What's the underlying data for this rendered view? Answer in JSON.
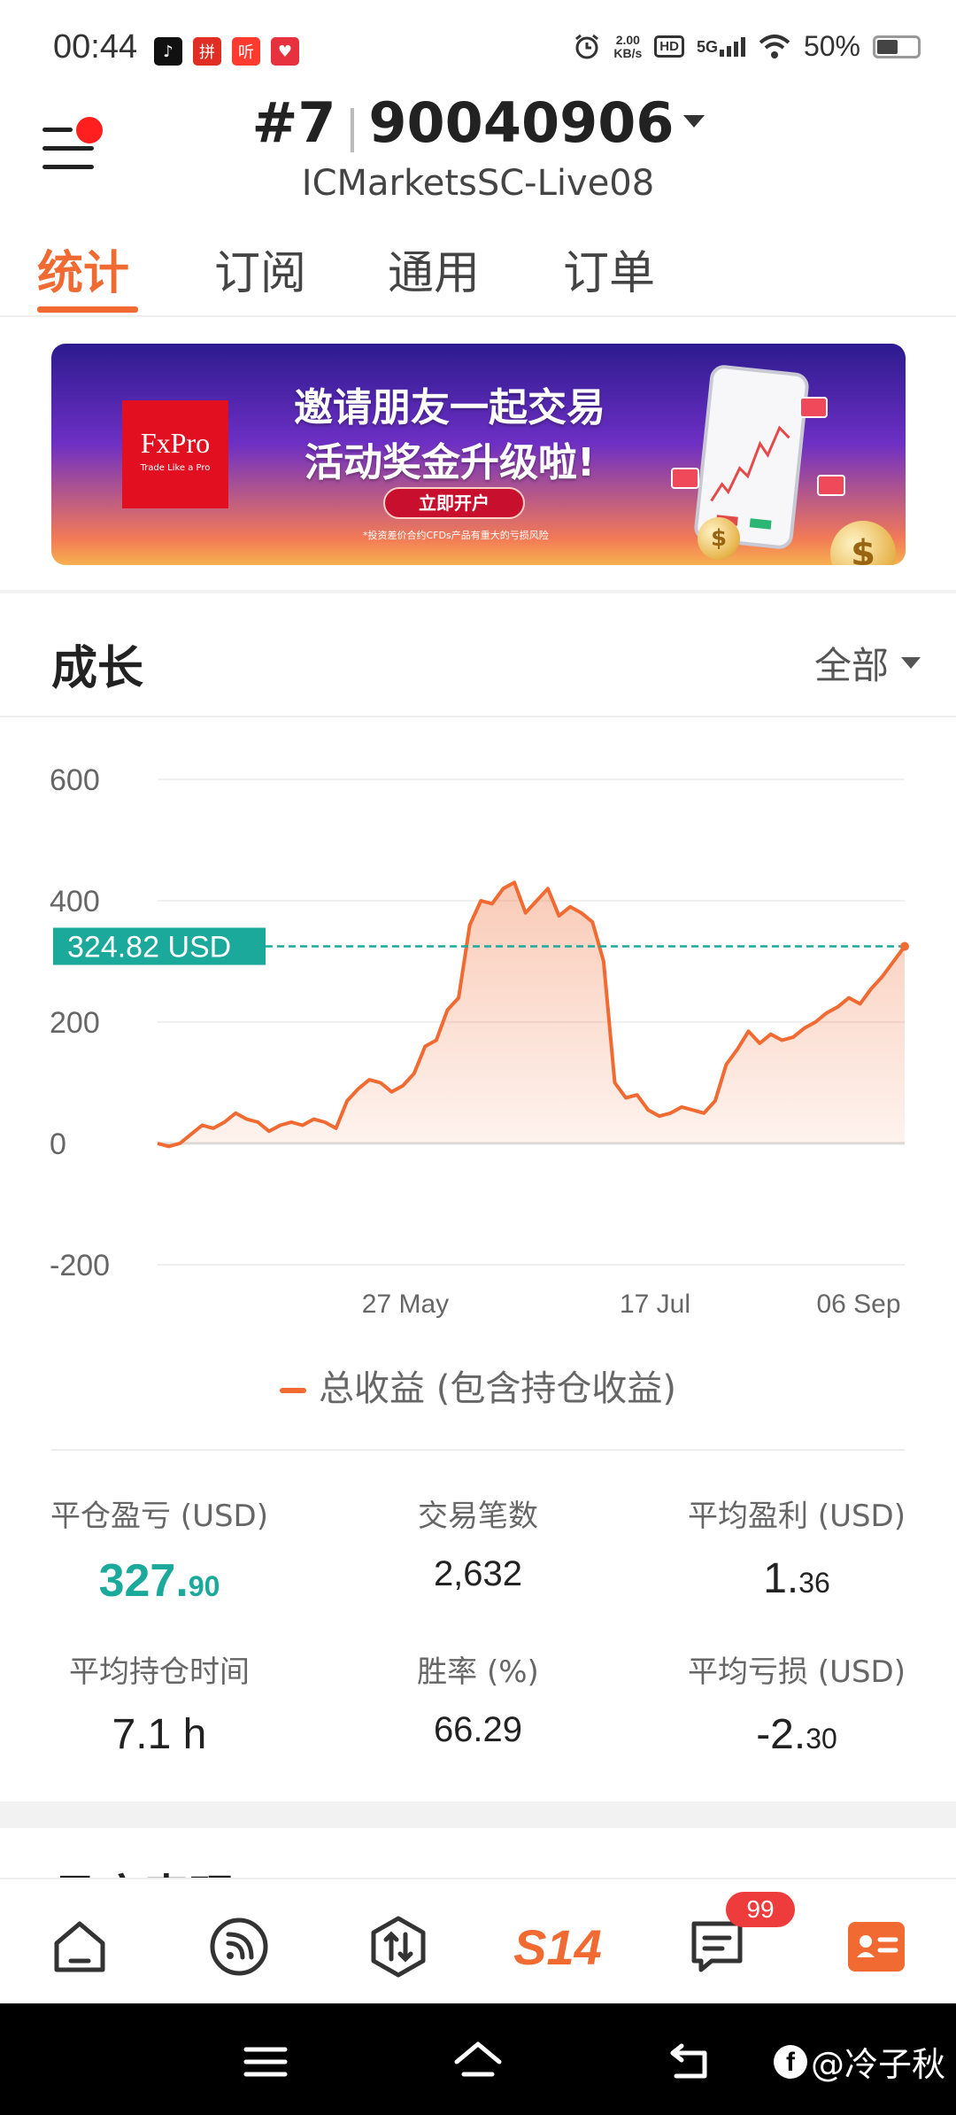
{
  "status_bar": {
    "time": "00:44",
    "net_speed_value": "2.00",
    "net_speed_unit": "KB/s",
    "hd": "HD",
    "network": "5G",
    "battery": "50%",
    "notification_icons": [
      "douyin-icon",
      "pinduoduo-icon",
      "ting-icon",
      "heart-app-icon"
    ]
  },
  "header": {
    "account_prefix": "#7",
    "account_number": "90040906",
    "server": "ICMarketsSC-Live08"
  },
  "tabs": [
    "统计",
    "订阅",
    "通用",
    "订单"
  ],
  "banner": {
    "brand": "FxPro",
    "brand_tagline": "Trade Like a Pro",
    "line1": "邀请朋友一起交易",
    "line2": "活动奖金升级啦!",
    "cta": "立即开户",
    "disclaimer": "*投资差价合约CFDs产品有重大的亏损风险"
  },
  "growth": {
    "title": "成长",
    "filter": "全部"
  },
  "chart_data": {
    "type": "area",
    "y_ticks": [
      "600",
      "400",
      "200",
      "0",
      "-200"
    ],
    "ylim": [
      -200,
      600
    ],
    "x_ticks": [
      "27 May",
      "17 Jul",
      "06 Sep"
    ],
    "grid": true,
    "legend_position": "bottom",
    "current_value_label": "324.82 USD",
    "current_value": 324.82,
    "line_color": "#f06a32",
    "reference_color": "#1aa99b",
    "series": [
      {
        "name": "总收益 (包含持仓收益)",
        "values": [
          0,
          -5,
          0,
          15,
          30,
          25,
          35,
          50,
          40,
          35,
          20,
          30,
          35,
          30,
          40,
          35,
          25,
          70,
          90,
          105,
          100,
          85,
          95,
          115,
          160,
          170,
          220,
          240,
          360,
          400,
          395,
          420,
          430,
          380,
          400,
          420,
          375,
          390,
          380,
          365,
          300,
          100,
          75,
          80,
          55,
          45,
          50,
          60,
          55,
          50,
          70,
          130,
          155,
          185,
          165,
          180,
          170,
          175,
          190,
          200,
          215,
          225,
          240,
          230,
          255,
          275,
          300,
          324.82
        ]
      }
    ]
  },
  "legend": {
    "label": "总收益 (包含持仓收益)"
  },
  "stats": [
    {
      "label": "平仓盈亏 (USD)",
      "value_main": "327.",
      "value_small": "90"
    },
    {
      "label": "交易笔数",
      "value_main": "2,632",
      "value_small": ""
    },
    {
      "label": "平均盈利 (USD)",
      "value_main": "1.",
      "value_small": "36"
    },
    {
      "label": "平均持仓时间",
      "value_main": "7.1 h",
      "value_small": ""
    },
    {
      "label": "胜率 (%)",
      "value_main": "66.29",
      "value_small": ""
    },
    {
      "label": "平均亏损 (USD)",
      "value_main": "-2.",
      "value_small": "30"
    }
  ],
  "next_section_title": "月度表现",
  "bottom_nav": {
    "items": [
      "home-icon",
      "signal-feed-icon",
      "trade-icon",
      "s14-logo",
      "messages-icon",
      "profile-card-icon"
    ],
    "s14_label": "S14",
    "badge": "99"
  },
  "watermark": "@冷子秋"
}
